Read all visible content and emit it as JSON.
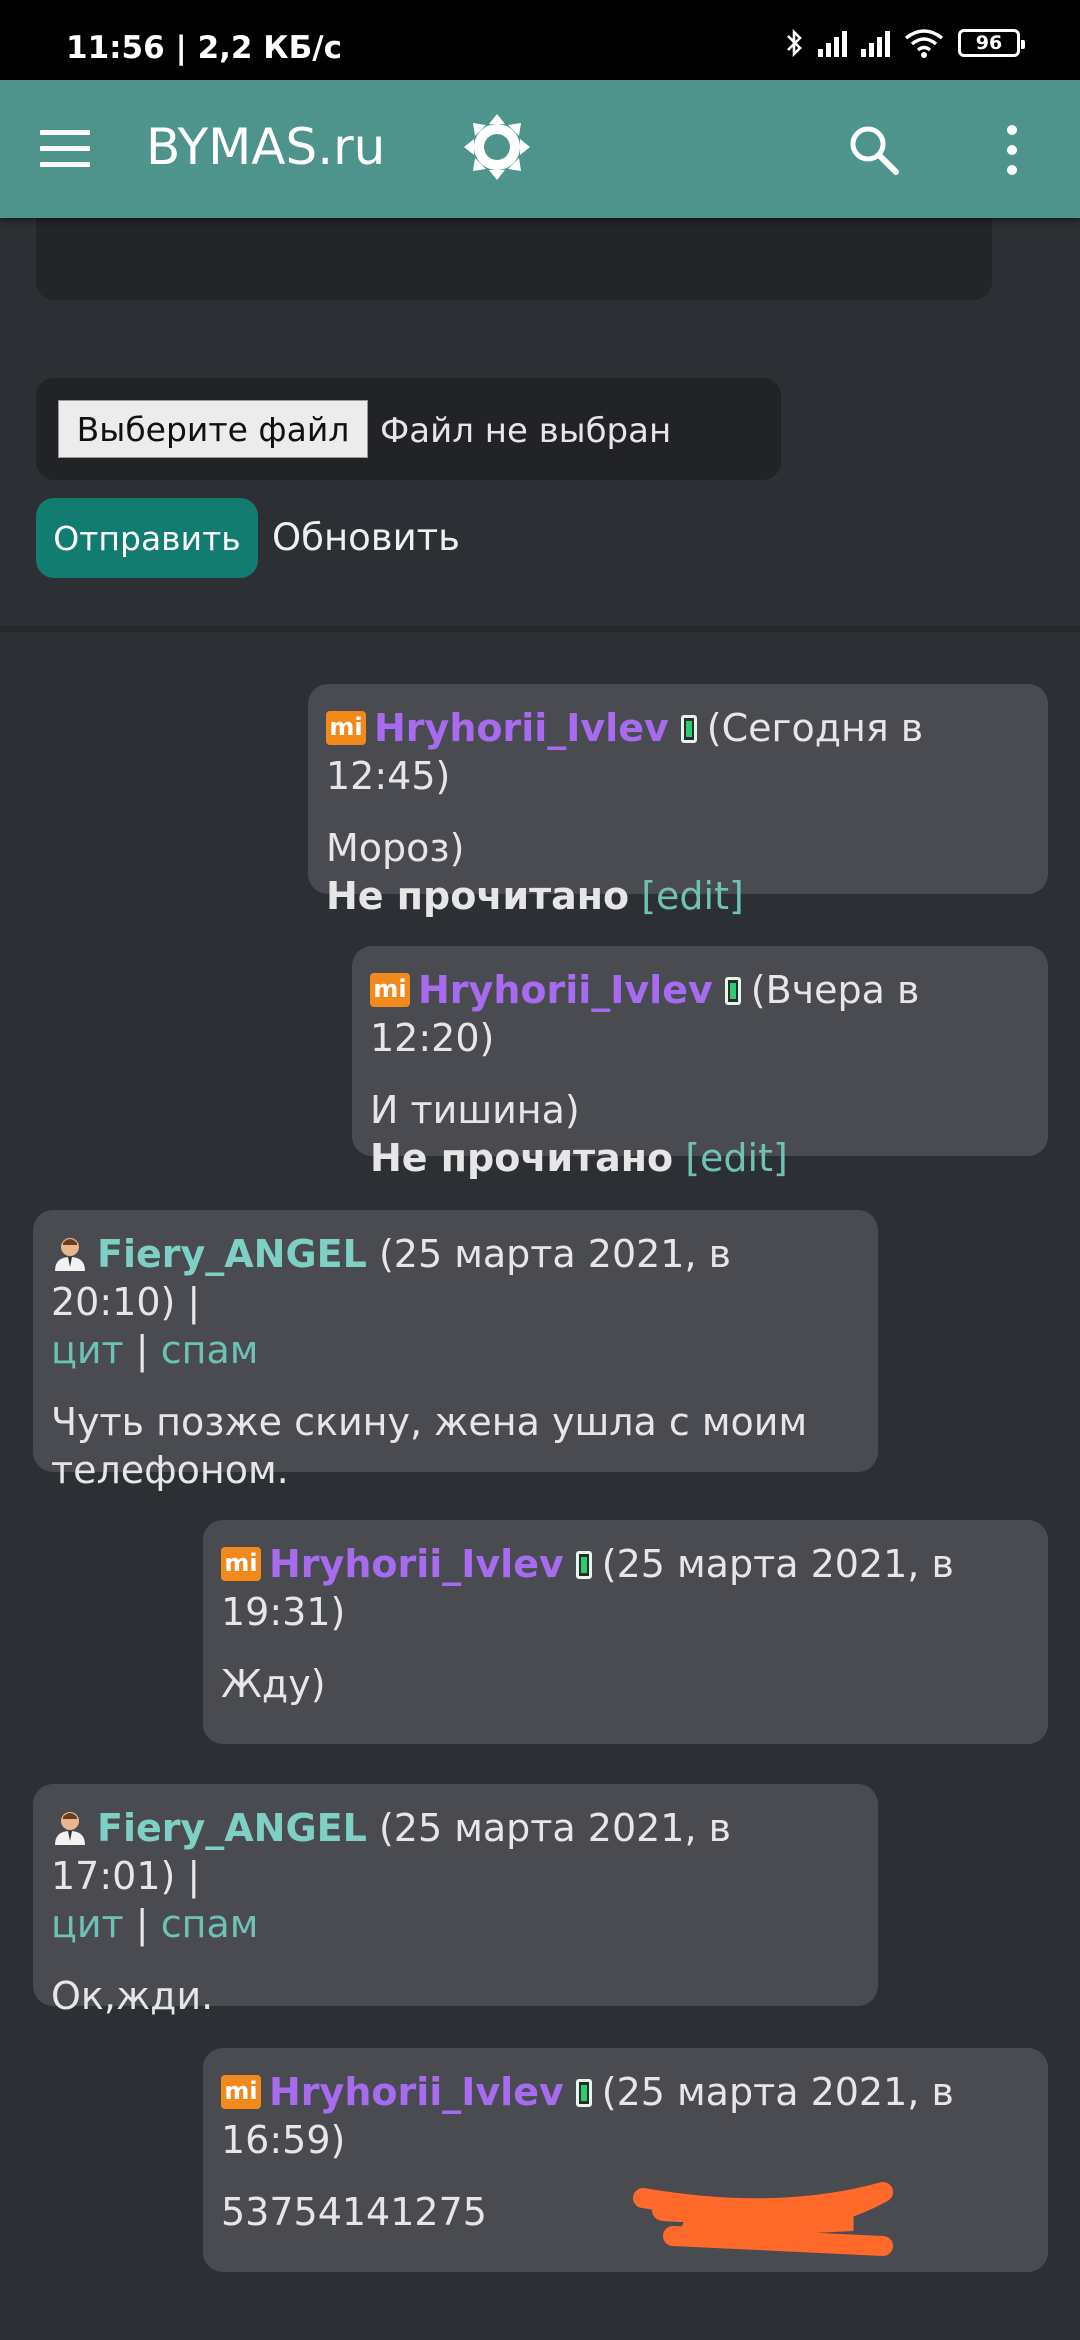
{
  "status_bar": {
    "time": "11:56 | 2,2 КБ/с",
    "battery": "96"
  },
  "app_bar": {
    "title": "BYMAS.ru"
  },
  "form": {
    "file_button": "Выберите файл",
    "file_status": "Файл не выбран",
    "send_button": "Отправить",
    "refresh_link": "Обновить"
  },
  "messages": [
    {
      "user": "Hryhorii_Ivlev",
      "time": "(Сегодня в 12:45)",
      "text": "Мороз)",
      "status": "Не прочитано",
      "edit": "[edit]"
    },
    {
      "user": "Hryhorii_Ivlev",
      "time": "(Вчера в 12:20)",
      "text": "И тишина)",
      "status": "Не прочитано",
      "edit": "[edit]"
    },
    {
      "user": "Fiery_ANGEL",
      "time": "(25 марта 2021, в 20:10) |",
      "quote": "цит",
      "sep": "|",
      "spam": "спам",
      "text": "Чуть позже скину, жена ушла с моим телефоном."
    },
    {
      "user": "Hryhorii_Ivlev",
      "time": "(25 марта 2021, в 19:31)",
      "text": "Жду)"
    },
    {
      "user": "Fiery_ANGEL",
      "time": "(25 марта 2021, в 17:01) |",
      "quote": "цит",
      "sep": "|",
      "spam": "спам",
      "text": "Ок,жди."
    },
    {
      "user": "Hryhorii_Ivlev",
      "time": "(25 марта 2021, в 16:59)",
      "text": "53754141275"
    }
  ],
  "colors": {
    "app_bar": "#4f948c",
    "send_button": "#137c70",
    "bubble": "#4a4b51",
    "mi_user": "#a76bf0",
    "user": "#7fd0c4",
    "link": "#6fc0b5",
    "redaction": "#ff6a2a"
  },
  "icons": [
    "menu-icon",
    "brightness-icon",
    "search-icon",
    "more-icon",
    "mi-icon",
    "phone-icon",
    "user-icon",
    "bluetooth-icon",
    "signal-icon",
    "wifi-icon",
    "battery-icon"
  ]
}
